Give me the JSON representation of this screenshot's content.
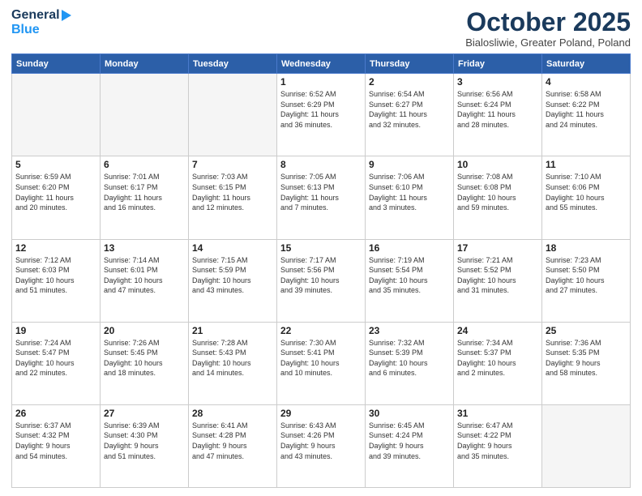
{
  "header": {
    "logo_general": "General",
    "logo_blue": "Blue",
    "month": "October 2025",
    "location": "Bialosliwie, Greater Poland, Poland"
  },
  "days_of_week": [
    "Sunday",
    "Monday",
    "Tuesday",
    "Wednesday",
    "Thursday",
    "Friday",
    "Saturday"
  ],
  "weeks": [
    {
      "cells": [
        {
          "day": "",
          "info": ""
        },
        {
          "day": "",
          "info": ""
        },
        {
          "day": "",
          "info": ""
        },
        {
          "day": "1",
          "info": "Sunrise: 6:52 AM\nSunset: 6:29 PM\nDaylight: 11 hours\nand 36 minutes."
        },
        {
          "day": "2",
          "info": "Sunrise: 6:54 AM\nSunset: 6:27 PM\nDaylight: 11 hours\nand 32 minutes."
        },
        {
          "day": "3",
          "info": "Sunrise: 6:56 AM\nSunset: 6:24 PM\nDaylight: 11 hours\nand 28 minutes."
        },
        {
          "day": "4",
          "info": "Sunrise: 6:58 AM\nSunset: 6:22 PM\nDaylight: 11 hours\nand 24 minutes."
        }
      ]
    },
    {
      "cells": [
        {
          "day": "5",
          "info": "Sunrise: 6:59 AM\nSunset: 6:20 PM\nDaylight: 11 hours\nand 20 minutes."
        },
        {
          "day": "6",
          "info": "Sunrise: 7:01 AM\nSunset: 6:17 PM\nDaylight: 11 hours\nand 16 minutes."
        },
        {
          "day": "7",
          "info": "Sunrise: 7:03 AM\nSunset: 6:15 PM\nDaylight: 11 hours\nand 12 minutes."
        },
        {
          "day": "8",
          "info": "Sunrise: 7:05 AM\nSunset: 6:13 PM\nDaylight: 11 hours\nand 7 minutes."
        },
        {
          "day": "9",
          "info": "Sunrise: 7:06 AM\nSunset: 6:10 PM\nDaylight: 11 hours\nand 3 minutes."
        },
        {
          "day": "10",
          "info": "Sunrise: 7:08 AM\nSunset: 6:08 PM\nDaylight: 10 hours\nand 59 minutes."
        },
        {
          "day": "11",
          "info": "Sunrise: 7:10 AM\nSunset: 6:06 PM\nDaylight: 10 hours\nand 55 minutes."
        }
      ]
    },
    {
      "cells": [
        {
          "day": "12",
          "info": "Sunrise: 7:12 AM\nSunset: 6:03 PM\nDaylight: 10 hours\nand 51 minutes."
        },
        {
          "day": "13",
          "info": "Sunrise: 7:14 AM\nSunset: 6:01 PM\nDaylight: 10 hours\nand 47 minutes."
        },
        {
          "day": "14",
          "info": "Sunrise: 7:15 AM\nSunset: 5:59 PM\nDaylight: 10 hours\nand 43 minutes."
        },
        {
          "day": "15",
          "info": "Sunrise: 7:17 AM\nSunset: 5:56 PM\nDaylight: 10 hours\nand 39 minutes."
        },
        {
          "day": "16",
          "info": "Sunrise: 7:19 AM\nSunset: 5:54 PM\nDaylight: 10 hours\nand 35 minutes."
        },
        {
          "day": "17",
          "info": "Sunrise: 7:21 AM\nSunset: 5:52 PM\nDaylight: 10 hours\nand 31 minutes."
        },
        {
          "day": "18",
          "info": "Sunrise: 7:23 AM\nSunset: 5:50 PM\nDaylight: 10 hours\nand 27 minutes."
        }
      ]
    },
    {
      "cells": [
        {
          "day": "19",
          "info": "Sunrise: 7:24 AM\nSunset: 5:47 PM\nDaylight: 10 hours\nand 22 minutes."
        },
        {
          "day": "20",
          "info": "Sunrise: 7:26 AM\nSunset: 5:45 PM\nDaylight: 10 hours\nand 18 minutes."
        },
        {
          "day": "21",
          "info": "Sunrise: 7:28 AM\nSunset: 5:43 PM\nDaylight: 10 hours\nand 14 minutes."
        },
        {
          "day": "22",
          "info": "Sunrise: 7:30 AM\nSunset: 5:41 PM\nDaylight: 10 hours\nand 10 minutes."
        },
        {
          "day": "23",
          "info": "Sunrise: 7:32 AM\nSunset: 5:39 PM\nDaylight: 10 hours\nand 6 minutes."
        },
        {
          "day": "24",
          "info": "Sunrise: 7:34 AM\nSunset: 5:37 PM\nDaylight: 10 hours\nand 2 minutes."
        },
        {
          "day": "25",
          "info": "Sunrise: 7:36 AM\nSunset: 5:35 PM\nDaylight: 9 hours\nand 58 minutes."
        }
      ]
    },
    {
      "cells": [
        {
          "day": "26",
          "info": "Sunrise: 6:37 AM\nSunset: 4:32 PM\nDaylight: 9 hours\nand 54 minutes."
        },
        {
          "day": "27",
          "info": "Sunrise: 6:39 AM\nSunset: 4:30 PM\nDaylight: 9 hours\nand 51 minutes."
        },
        {
          "day": "28",
          "info": "Sunrise: 6:41 AM\nSunset: 4:28 PM\nDaylight: 9 hours\nand 47 minutes."
        },
        {
          "day": "29",
          "info": "Sunrise: 6:43 AM\nSunset: 4:26 PM\nDaylight: 9 hours\nand 43 minutes."
        },
        {
          "day": "30",
          "info": "Sunrise: 6:45 AM\nSunset: 4:24 PM\nDaylight: 9 hours\nand 39 minutes."
        },
        {
          "day": "31",
          "info": "Sunrise: 6:47 AM\nSunset: 4:22 PM\nDaylight: 9 hours\nand 35 minutes."
        },
        {
          "day": "",
          "info": ""
        }
      ]
    }
  ]
}
